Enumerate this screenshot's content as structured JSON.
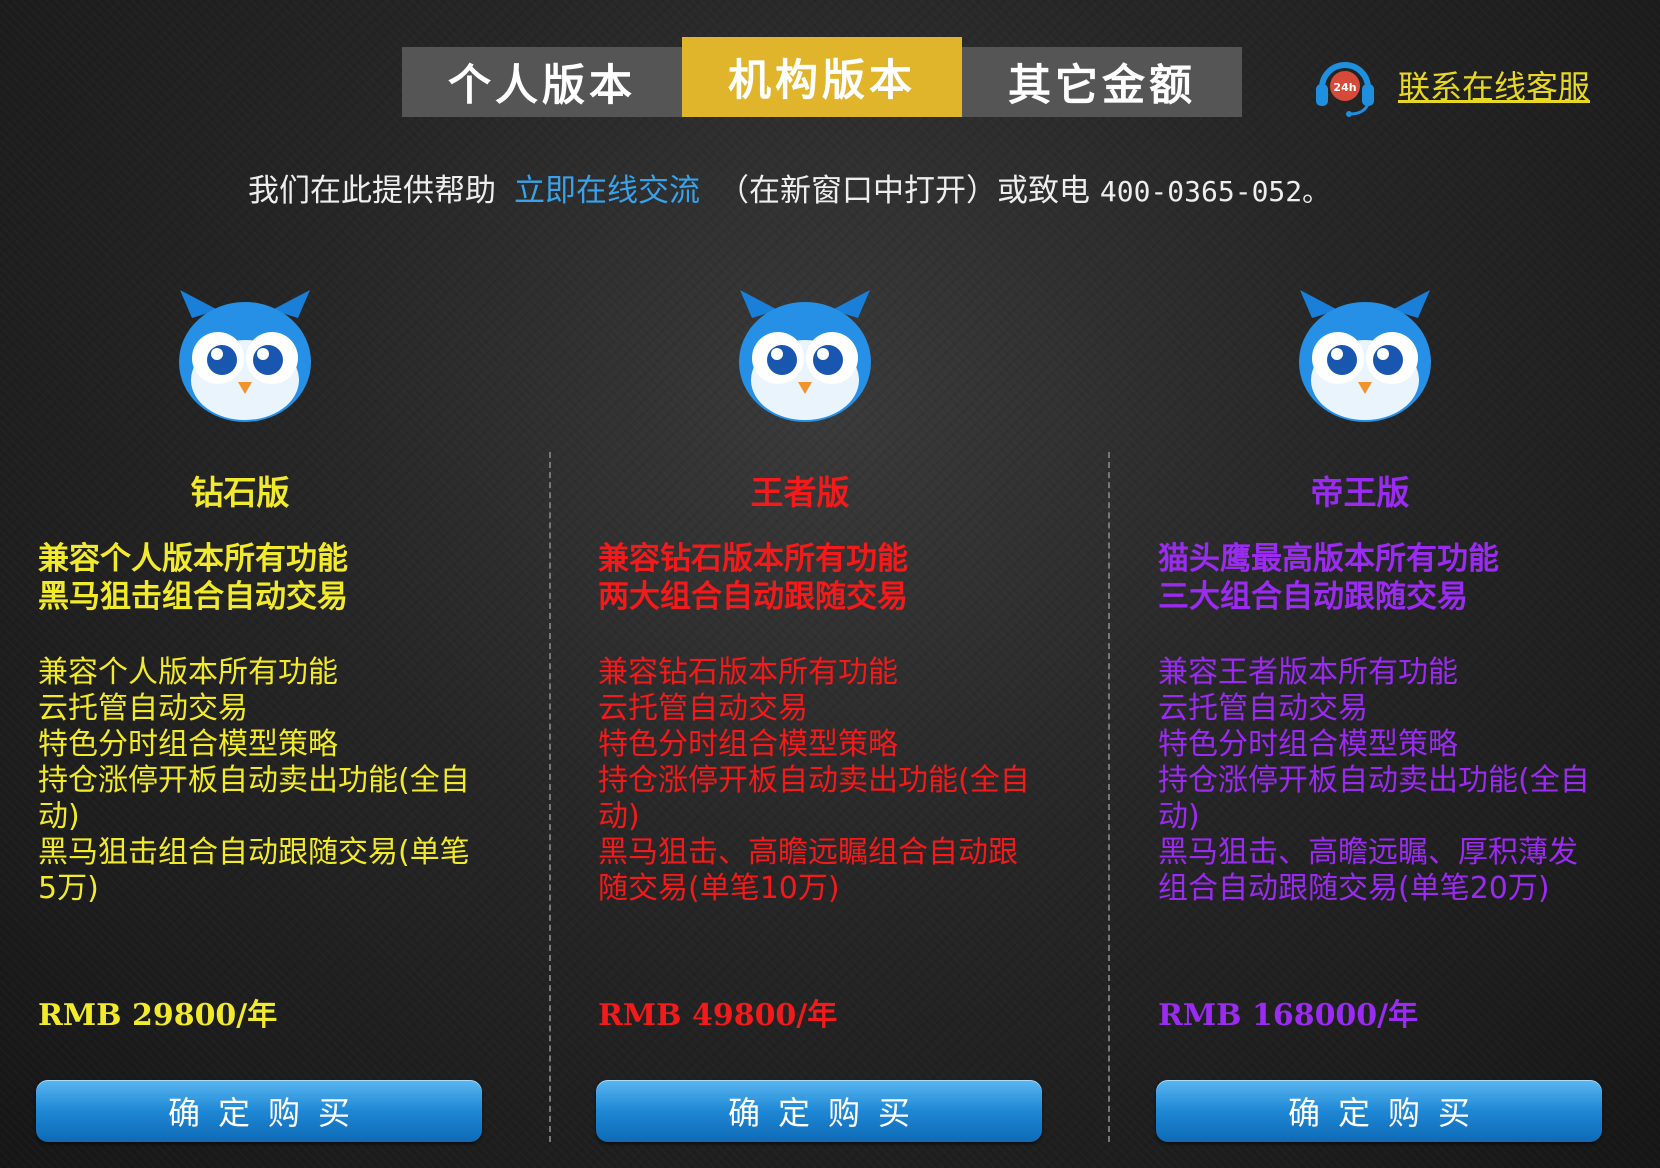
{
  "tabs": [
    {
      "label": "个人版本",
      "active": false
    },
    {
      "label": "机构版本",
      "active": true
    },
    {
      "label": "其它金额",
      "active": false
    }
  ],
  "support": {
    "icon": "headset-24h-icon",
    "badge": "24h",
    "link": "联系在线客服"
  },
  "help": {
    "prefix": "我们在此提供帮助",
    "link": "立即在线交流",
    "middle": "（在新窗口中打开）或致电",
    "phone": "400-0365-052。"
  },
  "colors": {
    "gold": "#f2ea2c",
    "red": "#f21a1a",
    "purple": "#9a2bf0",
    "link_blue": "#3aa2ea",
    "active_tab": "#e0b52c"
  },
  "plans": [
    {
      "title": "钻石版",
      "headline": [
        "兼容个人版本所有功能",
        "黑马狙击组合自动交易"
      ],
      "features": [
        "兼容个人版本所有功能",
        "云托管自动交易",
        "特色分时组合模型策略",
        "持仓涨停开板自动卖出功能(全自动)",
        "黑马狙击组合自动跟随交易(单笔5万)"
      ],
      "price": "RMB 29800/年",
      "button": "确定购买",
      "color": "#f2ea2c"
    },
    {
      "title": "王者版",
      "headline": [
        "兼容钻石版本所有功能",
        "两大组合自动跟随交易"
      ],
      "features": [
        "兼容钻石版本所有功能",
        "云托管自动交易",
        "特色分时组合模型策略",
        "持仓涨停开板自动卖出功能(全自动)",
        "黑马狙击、高瞻远瞩组合自动跟随交易(单笔10万)"
      ],
      "price": "RMB 49800/年",
      "button": "确定购买",
      "color": "#f21a1a"
    },
    {
      "title": "帝王版",
      "headline": [
        "猫头鹰最高版本所有功能",
        "三大组合自动跟随交易"
      ],
      "features": [
        "兼容王者版本所有功能",
        "云托管自动交易",
        "特色分时组合模型策略",
        "持仓涨停开板自动卖出功能(全自动)",
        "黑马狙击、高瞻远瞩、厚积薄发组合自动跟随交易(单笔20万)"
      ],
      "price": "RMB 168000/年",
      "button": "确定购买",
      "color": "#9a2bf0"
    }
  ]
}
